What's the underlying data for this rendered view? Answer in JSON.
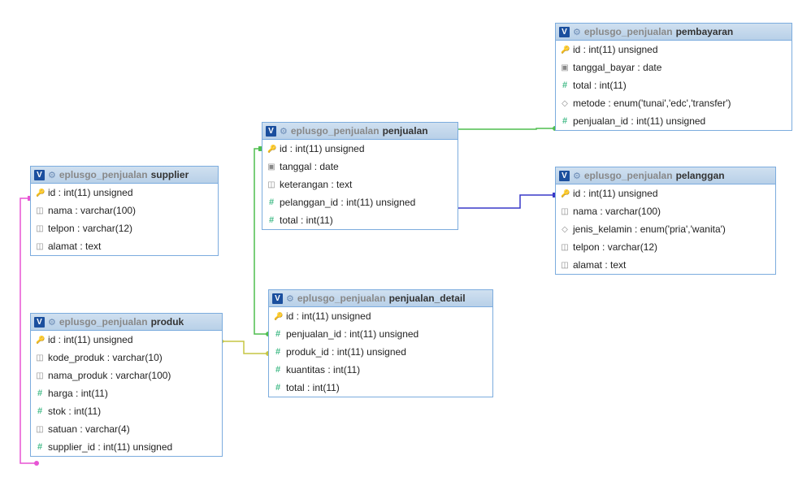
{
  "schema": "eplusgo_penjualan",
  "tables": {
    "supplier": {
      "name": "supplier",
      "columns": [
        {
          "icon": "pk",
          "label": "id : int(11) unsigned"
        },
        {
          "icon": "text",
          "label": "nama : varchar(100)"
        },
        {
          "icon": "text",
          "label": "telpon : varchar(12)"
        },
        {
          "icon": "text",
          "label": "alamat : text"
        }
      ]
    },
    "produk": {
      "name": "produk",
      "columns": [
        {
          "icon": "pk",
          "label": "id : int(11) unsigned"
        },
        {
          "icon": "text",
          "label": "kode_produk : varchar(10)"
        },
        {
          "icon": "text",
          "label": "nama_produk : varchar(100)"
        },
        {
          "icon": "num",
          "label": "harga : int(11)"
        },
        {
          "icon": "num",
          "label": "stok : int(11)"
        },
        {
          "icon": "text",
          "label": "satuan : varchar(4)"
        },
        {
          "icon": "num",
          "label": "supplier_id : int(11) unsigned"
        }
      ]
    },
    "penjualan": {
      "name": "penjualan",
      "columns": [
        {
          "icon": "pk",
          "label": "id : int(11) unsigned"
        },
        {
          "icon": "date",
          "label": "tanggal : date"
        },
        {
          "icon": "text",
          "label": "keterangan : text"
        },
        {
          "icon": "num",
          "label": "pelanggan_id : int(11) unsigned"
        },
        {
          "icon": "num",
          "label": "total : int(11)"
        }
      ]
    },
    "penjualan_detail": {
      "name": "penjualan_detail",
      "columns": [
        {
          "icon": "pk",
          "label": "id : int(11) unsigned"
        },
        {
          "icon": "num",
          "label": "penjualan_id : int(11) unsigned"
        },
        {
          "icon": "num",
          "label": "produk_id : int(11) unsigned"
        },
        {
          "icon": "num",
          "label": "kuantitas : int(11)"
        },
        {
          "icon": "num",
          "label": "total : int(11)"
        }
      ]
    },
    "pembayaran": {
      "name": "pembayaran",
      "columns": [
        {
          "icon": "pk",
          "label": "id : int(11) unsigned"
        },
        {
          "icon": "date",
          "label": "tanggal_bayar : date"
        },
        {
          "icon": "num",
          "label": "total : int(11)"
        },
        {
          "icon": "enum",
          "label": "metode : enum('tunai','edc','transfer')"
        },
        {
          "icon": "num",
          "label": "penjualan_id : int(11) unsigned"
        }
      ]
    },
    "pelanggan": {
      "name": "pelanggan",
      "columns": [
        {
          "icon": "pk",
          "label": "id : int(11) unsigned"
        },
        {
          "icon": "text",
          "label": "nama : varchar(100)"
        },
        {
          "icon": "enum",
          "label": "jenis_kelamin : enum('pria','wanita')"
        },
        {
          "icon": "text",
          "label": "telpon : varchar(12)"
        },
        {
          "icon": "text",
          "label": "alamat : text"
        }
      ]
    }
  },
  "chart_data": {
    "type": "table",
    "description": "Entity-relationship diagram (phpMyAdmin designer) for schema eplusgo_penjualan",
    "entities": [
      {
        "name": "supplier",
        "pk": "id",
        "columns": [
          "id int(11) unsigned",
          "nama varchar(100)",
          "telpon varchar(12)",
          "alamat text"
        ]
      },
      {
        "name": "produk",
        "pk": "id",
        "columns": [
          "id int(11) unsigned",
          "kode_produk varchar(10)",
          "nama_produk varchar(100)",
          "harga int(11)",
          "stok int(11)",
          "satuan varchar(4)",
          "supplier_id int(11) unsigned"
        ]
      },
      {
        "name": "penjualan",
        "pk": "id",
        "columns": [
          "id int(11) unsigned",
          "tanggal date",
          "keterangan text",
          "pelanggan_id int(11) unsigned",
          "total int(11)"
        ]
      },
      {
        "name": "penjualan_detail",
        "pk": "id",
        "columns": [
          "id int(11) unsigned",
          "penjualan_id int(11) unsigned",
          "produk_id int(11) unsigned",
          "kuantitas int(11)",
          "total int(11)"
        ]
      },
      {
        "name": "pembayaran",
        "pk": "id",
        "columns": [
          "id int(11) unsigned",
          "tanggal_bayar date",
          "total int(11)",
          "metode enum('tunai','edc','transfer')",
          "penjualan_id int(11) unsigned"
        ]
      },
      {
        "name": "pelanggan",
        "pk": "id",
        "columns": [
          "id int(11) unsigned",
          "nama varchar(100)",
          "jenis_kelamin enum('pria','wanita')",
          "telpon varchar(12)",
          "alamat text"
        ]
      }
    ],
    "relationships": [
      {
        "from": "produk.supplier_id",
        "to": "supplier.id",
        "color": "#E754D4"
      },
      {
        "from": "penjualan_detail.produk_id",
        "to": "produk.id",
        "color": "#C6C643"
      },
      {
        "from": "penjualan_detail.penjualan_id",
        "to": "penjualan.id",
        "color": "#4FBE4F"
      },
      {
        "from": "pembayaran.penjualan_id",
        "to": "penjualan.id",
        "color": "#4FBE4F"
      },
      {
        "from": "penjualan.pelanggan_id",
        "to": "pelanggan.id",
        "color": "#3838C8"
      }
    ]
  }
}
